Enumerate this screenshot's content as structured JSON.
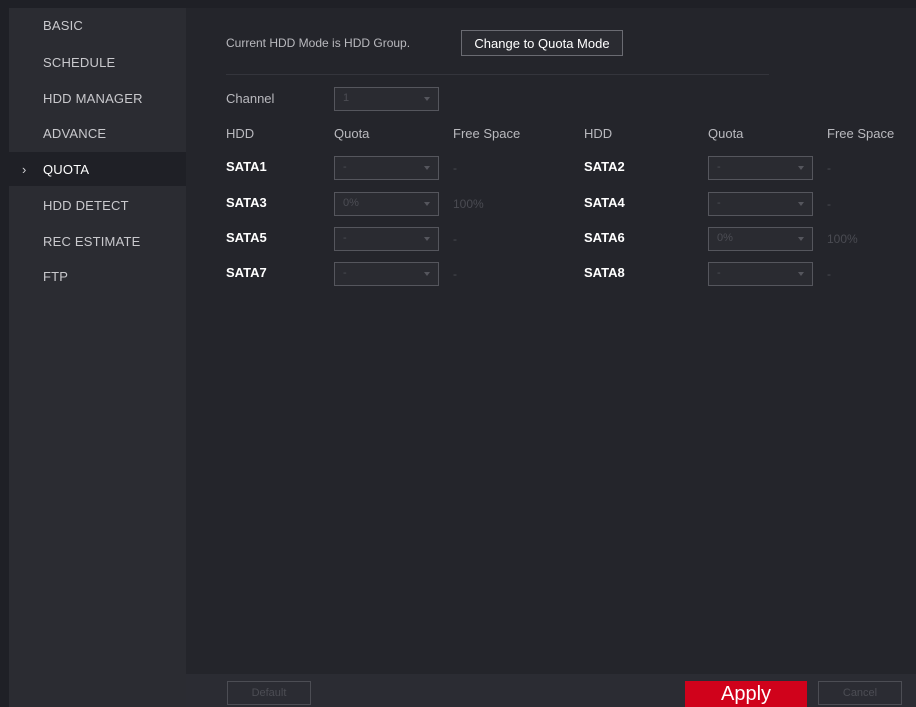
{
  "sidebar": {
    "items": [
      {
        "label": "BASIC"
      },
      {
        "label": "SCHEDULE"
      },
      {
        "label": "HDD MANAGER"
      },
      {
        "label": "ADVANCE"
      },
      {
        "label": "QUOTA"
      },
      {
        "label": "HDD DETECT"
      },
      {
        "label": "REC ESTIMATE"
      },
      {
        "label": "FTP"
      }
    ],
    "active_marker": "›"
  },
  "mode": {
    "text": "Current HDD Mode is HDD Group.",
    "button": "Change to Quota Mode"
  },
  "channel": {
    "label": "Channel",
    "value": "1"
  },
  "columns": {
    "hdd": "HDD",
    "quota": "Quota",
    "free": "Free Space"
  },
  "rows": [
    {
      "left": {
        "name": "SATA1",
        "quota": "-",
        "free": "-"
      },
      "right": {
        "name": "SATA2",
        "quota": "-",
        "free": "-"
      }
    },
    {
      "left": {
        "name": "SATA3",
        "quota": "0%",
        "free": "100%"
      },
      "right": {
        "name": "SATA4",
        "quota": "-",
        "free": "-"
      }
    },
    {
      "left": {
        "name": "SATA5",
        "quota": "-",
        "free": "-"
      },
      "right": {
        "name": "SATA6",
        "quota": "0%",
        "free": "100%"
      }
    },
    {
      "left": {
        "name": "SATA7",
        "quota": "-",
        "free": "-"
      },
      "right": {
        "name": "SATA8",
        "quota": "-",
        "free": "-"
      }
    }
  ],
  "footer": {
    "default": "Default",
    "apply": "Apply",
    "cancel": "Cancel"
  },
  "colors": {
    "apply": "#d0021b",
    "background": "#24252b",
    "sidebar": "#2b2c32"
  }
}
